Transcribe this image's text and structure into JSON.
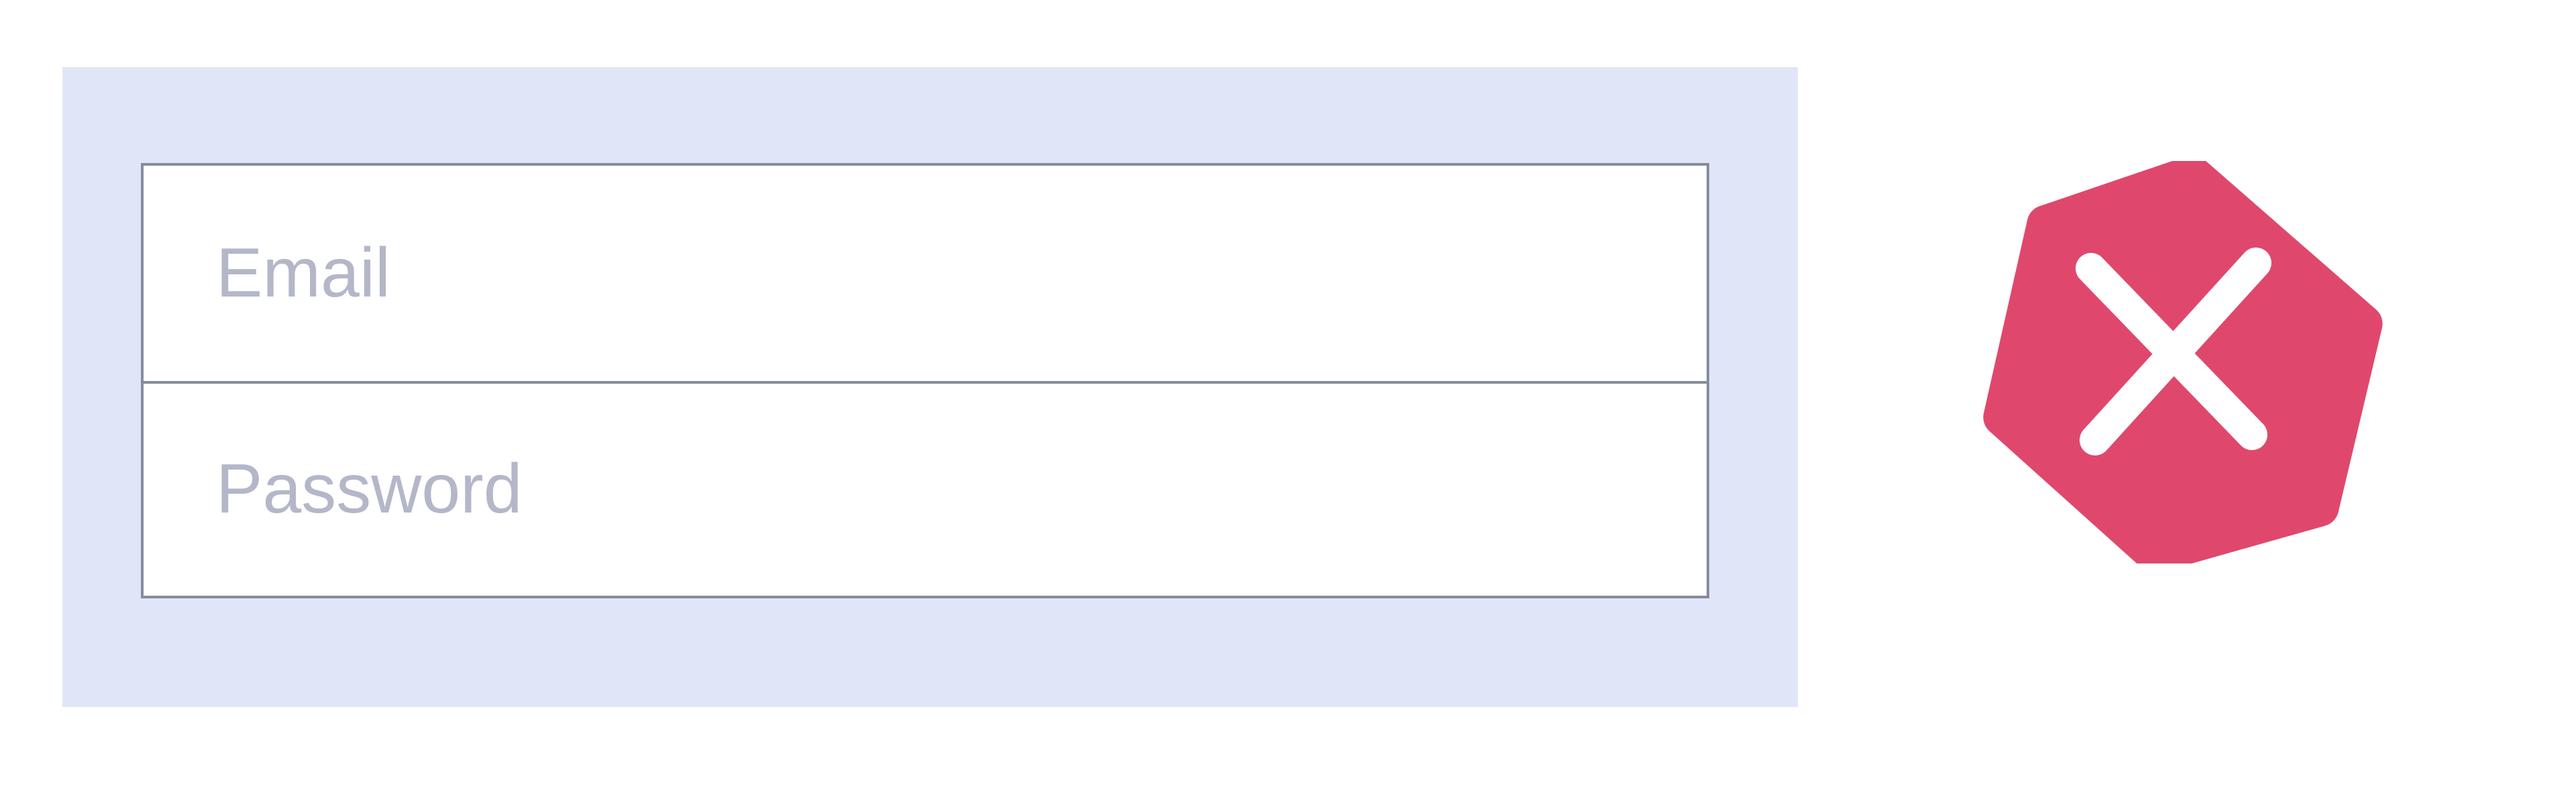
{
  "login_form": {
    "email_placeholder": "Email",
    "email_value": "",
    "password_placeholder": "Password",
    "password_value": ""
  },
  "error_badge": {
    "icon": "close-icon",
    "color": "#df486c",
    "glyph_color": "#ffffff"
  },
  "colors": {
    "panel_background": "#e0e6f8",
    "field_border": "#858c9e",
    "placeholder_text": "#b3b7c8"
  }
}
